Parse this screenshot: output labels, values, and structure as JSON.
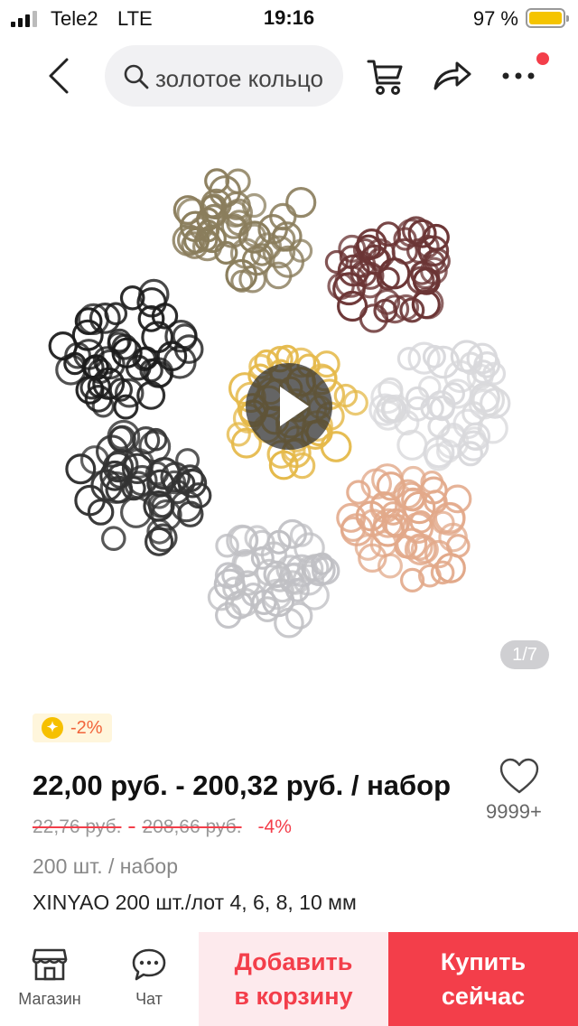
{
  "status_bar": {
    "carrier": "Tele2",
    "network": "LTE",
    "time": "19:16",
    "battery_percent": "97 %",
    "battery_level": 0.97
  },
  "header": {
    "back_icon": "chevron-left-icon",
    "search_placeholder": "золотое кольцо",
    "cart_icon": "cart-icon",
    "share_icon": "share-icon",
    "more_icon": "more-icon",
    "notification_color": "#f33e4a"
  },
  "gallery": {
    "image_counter": "1/7",
    "play_icon": "play-icon",
    "ring_colors": [
      "#8a7d5c",
      "#6b3535",
      "#1c1c1c",
      "#e5b94a",
      "#d9d9dc",
      "#333333",
      "#c0c0c4",
      "#e2a98a"
    ]
  },
  "product": {
    "discount_badge": "-2%",
    "price": "22,00 руб. - 200,32 руб. / набор",
    "old_price_low": "22,76 руб.",
    "old_price_sep": "-",
    "old_price_high": "208,66 руб.",
    "percent_off": "-4%",
    "wishlist_count": "9999+",
    "unit": "200 шт. / набор",
    "title": "XINYAO 200 шт./лот 4, 6, 8, 10 мм"
  },
  "bottom_bar": {
    "store_label": "Магазин",
    "chat_label": "Чат",
    "add_to_cart_line1": "Добавить",
    "add_to_cart_line2": "в корзину",
    "buy_line1": "Купить",
    "buy_line2": "сейчас"
  },
  "colors": {
    "accent": "#f33e4a",
    "accent_light": "#fdeaed",
    "badge_bg": "#fff6dc",
    "coin": "#f6c000"
  }
}
